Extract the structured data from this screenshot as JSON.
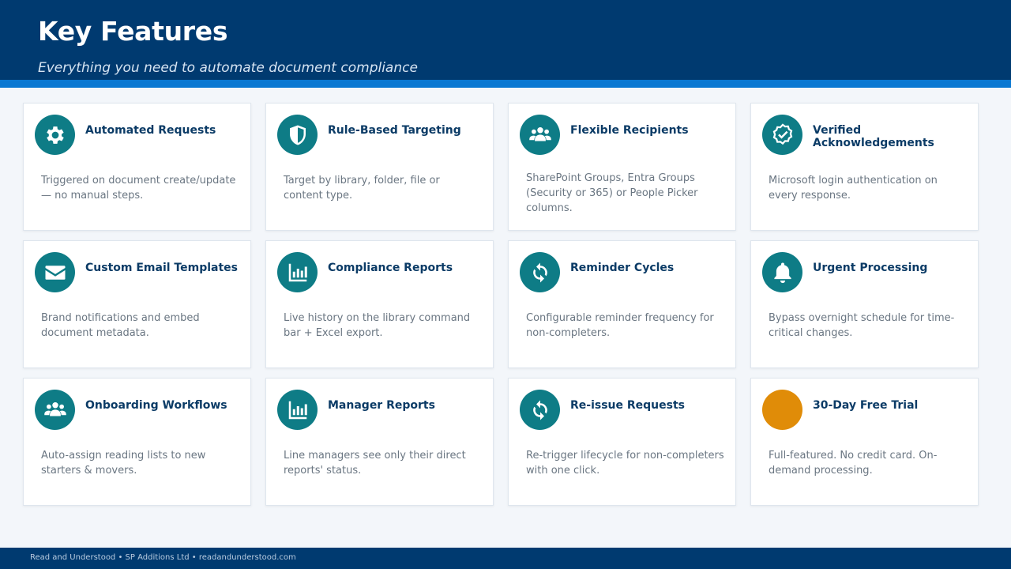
{
  "header": {
    "title": "Key Features",
    "subtitle": "Everything you need to automate document compliance"
  },
  "colors": {
    "header_bg": "#003a70",
    "stripe": "#0a78d2",
    "icon_teal": "#0e7c86",
    "icon_orange": "#e08c08",
    "title_text": "#0b3b66"
  },
  "features": [
    {
      "icon": "gear-icon",
      "title": "Automated Requests",
      "desc": "Triggered on document create/update — no manual steps."
    },
    {
      "icon": "shield-icon",
      "title": "Rule-Based Targeting",
      "desc": "Target by library, folder, file or content type."
    },
    {
      "icon": "users-icon",
      "title": "Flexible Recipients",
      "desc": "SharePoint Groups, Entra Groups (Security or 365) or People Picker columns."
    },
    {
      "icon": "verified-badge-icon",
      "title": "Verified Acknowledgements",
      "desc": "Microsoft login authentication on every response."
    },
    {
      "icon": "envelope-icon",
      "title": "Custom Email Templates",
      "desc": "Brand notifications and embed document metadata."
    },
    {
      "icon": "bar-chart-icon",
      "title": "Compliance Reports",
      "desc": "Live history on the library command bar + Excel export."
    },
    {
      "icon": "refresh-icon",
      "title": "Reminder Cycles",
      "desc": "Configurable reminder frequency for non-completers."
    },
    {
      "icon": "bell-icon",
      "title": "Urgent Processing",
      "desc": "Bypass overnight schedule for time-critical changes."
    },
    {
      "icon": "users-icon",
      "title": "Onboarding Workflows",
      "desc": "Auto-assign reading lists to new starters & movers."
    },
    {
      "icon": "bar-chart-icon",
      "title": "Manager Reports",
      "desc": "Line managers see only their direct reports' status."
    },
    {
      "icon": "refresh-icon",
      "title": "Re-issue Requests",
      "desc": "Re-trigger lifecycle for non-completers with one click."
    },
    {
      "icon": "circle-icon",
      "title": "30-Day Free Trial",
      "desc": "Full-featured. No credit card. On-demand processing."
    }
  ],
  "footer": {
    "text": "Read and Understood  •  SP Additions Ltd  •  readandunderstood.com"
  }
}
